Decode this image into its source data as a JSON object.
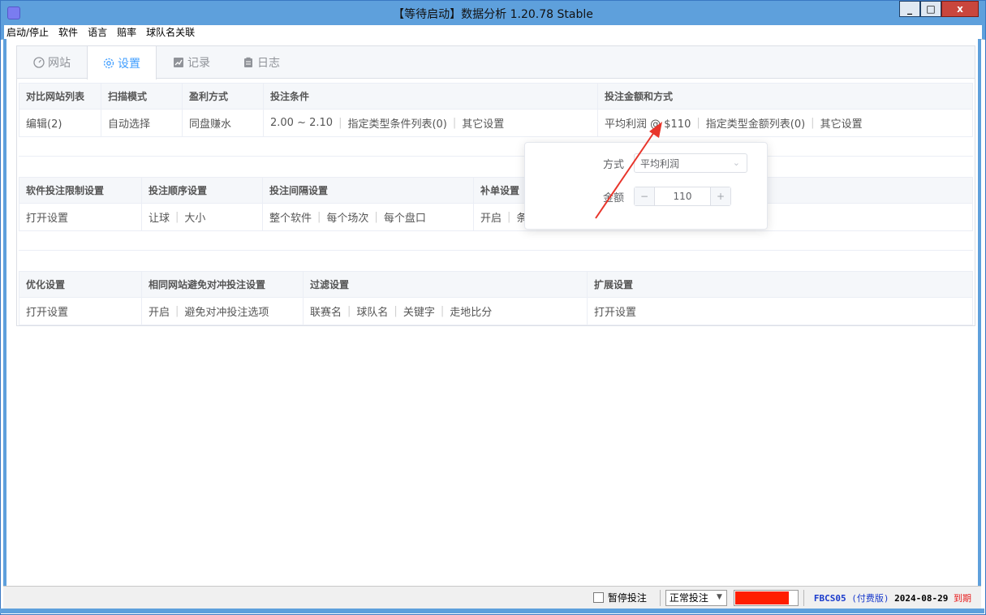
{
  "window": {
    "title": "【等待启动】数据分析 1.20.78 Stable",
    "min_label": "_",
    "max_label": "□",
    "close_label": "x"
  },
  "menu": [
    "启动/停止",
    "软件",
    "语言",
    "赔率",
    "球队名关联"
  ],
  "tabs": [
    {
      "label": "网站",
      "icon": "gauge-icon",
      "active": false
    },
    {
      "label": "设置",
      "icon": "gear-icon",
      "active": true
    },
    {
      "label": "记录",
      "icon": "chart-icon",
      "active": false
    },
    {
      "label": "日志",
      "icon": "clipboard-icon",
      "active": false
    }
  ],
  "section1": {
    "headers": [
      "对比网站列表",
      "扫描模式",
      "盈利方式",
      "投注条件",
      "投注金额和方式"
    ],
    "values": {
      "compare": "编辑(2)",
      "scan": "自动选择",
      "profit": "同盘赚水",
      "cond_range": "2.00 ~ 2.10",
      "cond_list": "指定类型条件列表(0)",
      "cond_other": "其它设置",
      "amount_method": "平均利润 @ $110",
      "amount_list": "指定类型金额列表(0)",
      "amount_other": "其它设置"
    }
  },
  "section2": {
    "headers": [
      "软件投注限制设置",
      "投注顺序设置",
      "投注间隔设置",
      "补单设置"
    ],
    "values": {
      "limit": "打开设置",
      "order_a": "让球",
      "order_b": "大小",
      "int_a": "整个软件",
      "int_b": "每个场次",
      "int_c": "每个盘口",
      "supp_a": "开启",
      "supp_b": "条"
    }
  },
  "section3": {
    "headers": [
      "优化设置",
      "相同网站避免对冲投注设置",
      "过滤设置",
      "扩展设置"
    ],
    "values": {
      "opt": "打开设置",
      "avoid_a": "开启",
      "avoid_b": "避免对冲投注选项",
      "filter_a": "联赛名",
      "filter_b": "球队名",
      "filter_c": "关键字",
      "filter_d": "走地比分",
      "ext": "打开设置"
    }
  },
  "popover": {
    "method_label": "方式",
    "method_value": "平均利润",
    "amount_label": "金额",
    "amount_value": "110",
    "minus": "−",
    "plus": "+"
  },
  "status": {
    "pause_label": "暂停投注",
    "pause_checked": false,
    "mode_value": "正常投注",
    "progress_fraction": 0.85,
    "license_code": "FBCS05",
    "license_type": "(付费版)",
    "license_date": "2024-08-29",
    "license_expiry": "到期"
  },
  "colors": {
    "accent": "#409eff",
    "title_bar": "#5ea0dc",
    "progress": "#ff1e00",
    "annotation_arrow": "#e8352b"
  }
}
